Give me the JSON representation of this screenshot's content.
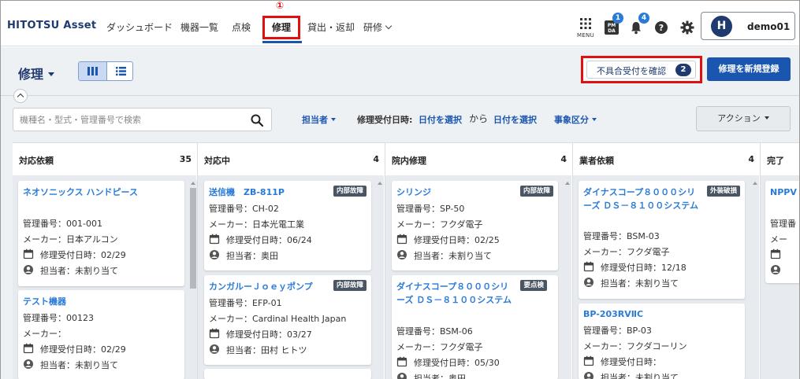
{
  "header": {
    "logo_main": "HITOTSU Asset",
    "nav": [
      {
        "label": "ダッシュボード"
      },
      {
        "label": "機器一覧"
      },
      {
        "label": "点検"
      },
      {
        "label": "修理"
      },
      {
        "label": "貸出・返却"
      },
      {
        "label": "研修"
      }
    ],
    "annotation_marker": "①",
    "menu_label": "MENU",
    "pmda_badge": "1",
    "bell_badge": "4",
    "user_initial": "H",
    "user_name": "demo01"
  },
  "toolbar": {
    "page_title": "修理",
    "defect_label": "不具合受付を確認",
    "defect_count": "2",
    "new_repair_label": "修理を新規登録",
    "search_placeholder": "機種名・型式・管理番号で検索",
    "filter_assignee": "担当者",
    "filter_date_label": "修理受付日時:",
    "filter_date_from": "日付を選択",
    "filter_from_word": "から",
    "filter_date_to": "日付を選択",
    "filter_category": "事象区分",
    "action_label": "アクション"
  },
  "columns": [
    {
      "title": "対応依頼",
      "count": "35",
      "cards": [
        {
          "title": "ネオソニックス ハンドピース",
          "mgmt": "管理番号：001-001",
          "maker": "メーカー：日本アルコン",
          "date": "修理受付日時：02/29",
          "assignee": "担当者：未割り当て"
        },
        {
          "title": "テスト機器",
          "mgmt": "管理番号：00123",
          "maker": "メーカー：",
          "date": "修理受付日時：02/29",
          "assignee": "担当者：未割り当て"
        }
      ]
    },
    {
      "title": "対応中",
      "count": "4",
      "cards": [
        {
          "title": "送信機　ZB-811P",
          "tag": "内部故障",
          "mgmt": "管理番号：CH-02",
          "maker": "メーカー：日本光電工業",
          "date": "修理受付日時：06/24",
          "assignee": "担当者：奥田"
        },
        {
          "title": "カンガルーＪｏｅｙポンプ",
          "tag": "内部故障",
          "mgmt": "管理番号：EFP-01",
          "maker": "メーカー：Cardinal Health Japan",
          "date": "修理受付日時：03/27",
          "assignee": "担当者：田村 ヒトツ"
        }
      ]
    },
    {
      "title": "院内修理",
      "count": "4",
      "cards": [
        {
          "title": "シリンジ",
          "tag": "内部故障",
          "mgmt": "管理番号：SP-50",
          "maker": "メーカー：フクダ電子",
          "date": "修理受付日時：02/25",
          "assignee": "担当者：未割り当て"
        },
        {
          "title": "ダイナスコープ８０００シリーズ ＤＳ－８１００システム",
          "tag": "要点検",
          "mgmt": "管理番号：BSM-06",
          "maker": "メーカー：フクダ電子",
          "date": "修理受付日時：05/30",
          "assignee": "担当者：奥田"
        }
      ]
    },
    {
      "title": "業者依頼",
      "count": "4",
      "cards": [
        {
          "title": "ダイナスコープ８０００シリーズ ＤＳ－８１００システム",
          "tag": "外装破損",
          "mgmt": "管理番号：BSM-03",
          "maker": "メーカー：フクダ電子",
          "date": "修理受付日時：12/18",
          "assignee": "担当者：未割り当て"
        },
        {
          "title": "BP-203RVⅡC",
          "mgmt": "管理番号：BP-03",
          "maker": "メーカー：フクダコーリン",
          "date": "修理受付日時：",
          "assignee": "担当者：未割り当て"
        }
      ]
    },
    {
      "title": "完了",
      "cards": [
        {
          "title": "NPPV クシ",
          "mgmt": "管理番",
          "maker": "メー"
        }
      ]
    }
  ]
}
